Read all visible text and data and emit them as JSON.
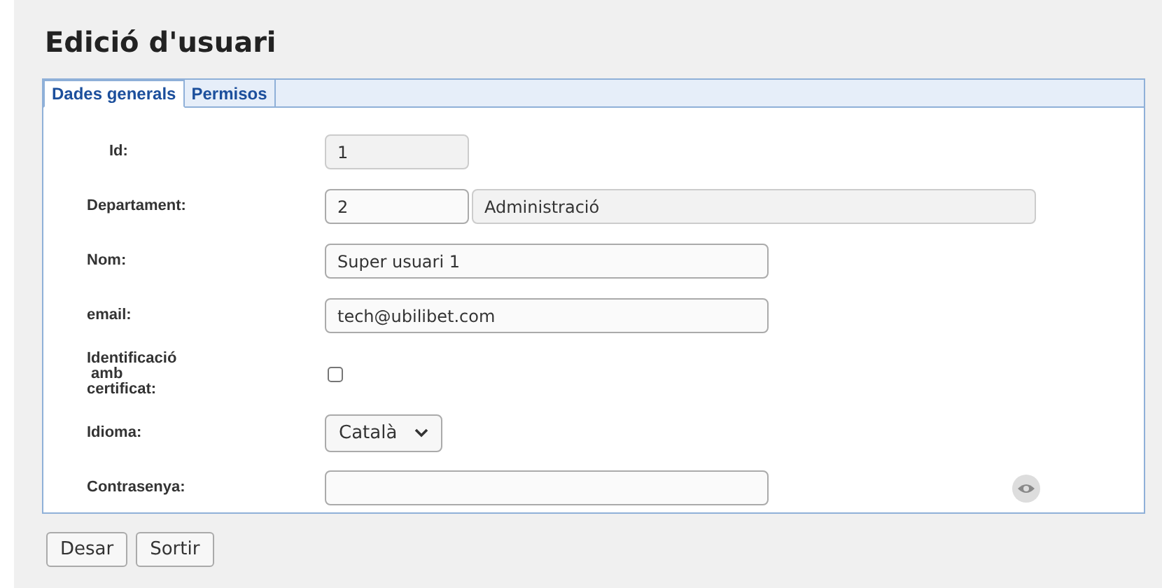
{
  "page": {
    "title": "Edició d'usuari"
  },
  "tabs": [
    {
      "label": "Dades generals",
      "selected": true
    },
    {
      "label": "Permisos",
      "selected": false
    }
  ],
  "fields": [
    {
      "kind": "text",
      "label": "Id:",
      "value": "1",
      "disabled": true
    },
    {
      "kind": "lookup",
      "label": "Departament:",
      "value": "2",
      "description": "Administració",
      "disabled": false
    },
    {
      "kind": "text",
      "label": "Nom:",
      "value": "Super usuari 1",
      "disabled": false
    },
    {
      "kind": "text",
      "label": "email:",
      "value": "tech@ubilibet.com",
      "disabled": false
    },
    {
      "kind": "checkbox",
      "label": "Identificació\n amb\ncertificat:",
      "checked": false
    },
    {
      "kind": "select",
      "label": "Idioma:",
      "value": "Català"
    },
    {
      "kind": "password",
      "label": "Contrasenya:"
    }
  ],
  "buttons": [
    "Desar",
    "Sortir"
  ]
}
